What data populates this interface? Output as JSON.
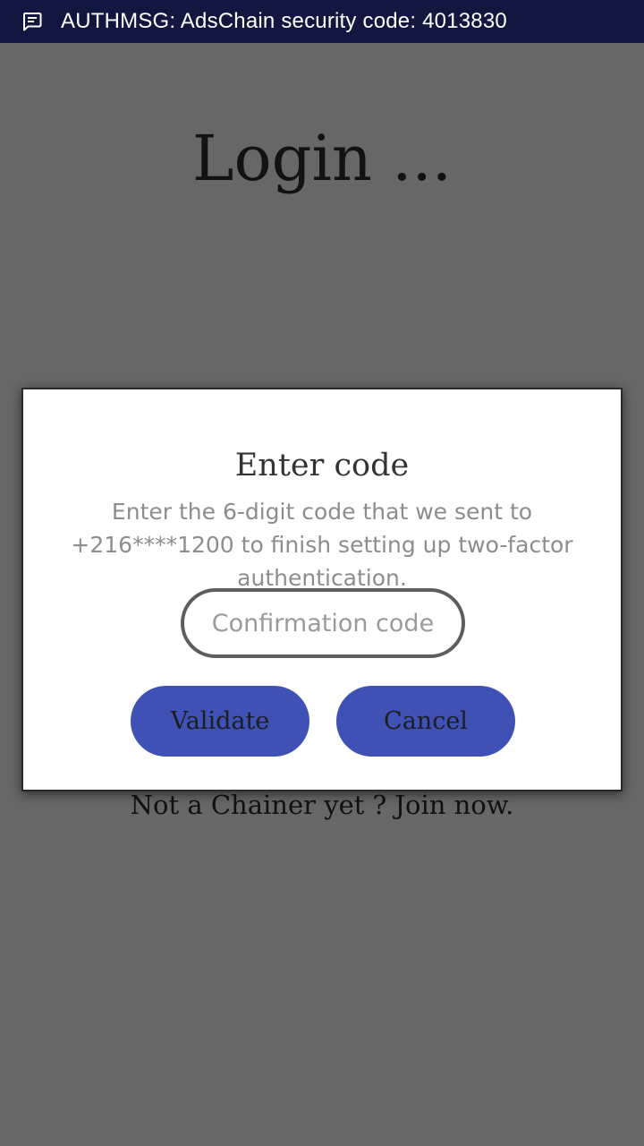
{
  "notification": {
    "icon": "message-icon",
    "text": "AUTHMSG: AdsChain security code: 4013830",
    "background": "#12173f"
  },
  "page": {
    "title": "Login ...",
    "join_link": "Not a Chainer yet ? Join now.",
    "background": "#676767"
  },
  "dialog": {
    "title": "Enter code",
    "message": "Enter the 6-digit code that we sent to +216****1200 to finish setting up two-factor authentication.",
    "input": {
      "placeholder": "Confirmation code",
      "value": ""
    },
    "buttons": {
      "validate": "Validate",
      "cancel": "Cancel"
    },
    "button_color": "#3f51b5"
  }
}
